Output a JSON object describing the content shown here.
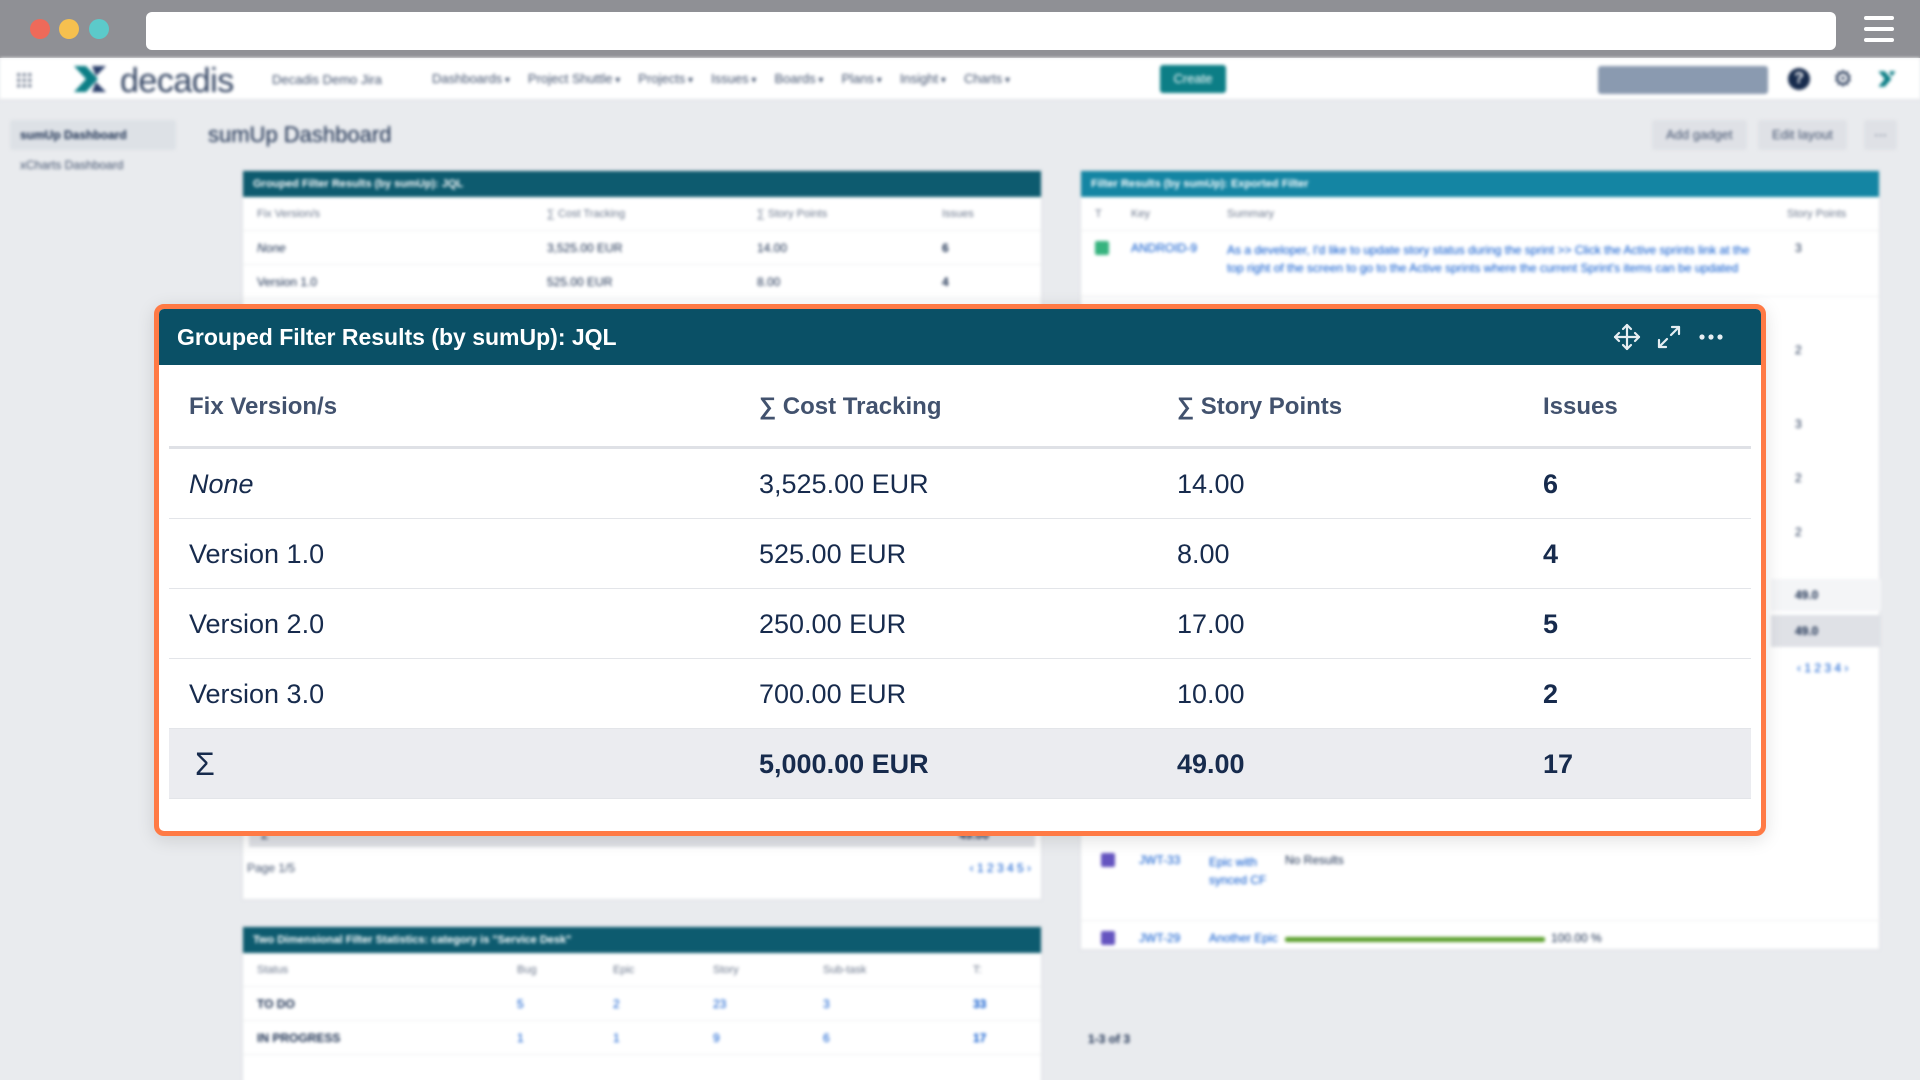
{
  "browser": {
    "url": ""
  },
  "nav": {
    "logo_text": "decadis",
    "site_name": "Decadis Demo Jira",
    "items": [
      "Dashboards",
      "Project Shuttle",
      "Projects",
      "Issues",
      "Boards",
      "Plans",
      "Insight",
      "Charts"
    ],
    "create_label": "Create",
    "help_glyph": "?",
    "gear_glyph": "⚙"
  },
  "sidebar": {
    "items": [
      "sumUp Dashboard",
      "xCharts Dashboard"
    ]
  },
  "dashboard": {
    "title": "sumUp Dashboard",
    "add_gadget_label": "Add gadget",
    "edit_layout_label": "Edit layout",
    "more_label": "···"
  },
  "bg_gadgets": {
    "grouped_title": "Grouped Filter Results (by sumUp): JQL",
    "grouped_page": "Page 1/5",
    "grouped_pages": "‹ 1 2 3 4 5 ›",
    "filter_title": "Filter Results (by sumUp): Exported Filter",
    "filter_cols": [
      "T",
      "Key",
      "Summary",
      "Story Points"
    ],
    "filter_key": "ANDROID-9",
    "filter_summary": "As a developer, I'd like to update story status during the sprint >> Click the Active sprints link at the top right of the screen to go to the Active sprints where the current Sprint's items can be updated",
    "filter_sp": [
      "3",
      "2",
      "3",
      "2",
      "2"
    ],
    "filter_total": "49.0",
    "filter_pages": "‹ 1 2 3 4 ›",
    "jwt33_key": "JWT-33",
    "jwt33_type": "Epic with synced CF",
    "jwt33_result": "No Results",
    "jwt29_key": "JWT-29",
    "jwt29_type": "Another Epic",
    "jwt29_pct": "100.00 %",
    "jwt29_progress": 1.0,
    "range": "1-3 of 3",
    "two_dim_title": "Two Dimensional Filter Statistics: category is \"Service Desk\"",
    "two_dim_cols": [
      "Status",
      "Bug",
      "Epic",
      "Story",
      "Sub-task",
      "T:"
    ],
    "two_dim_rows": [
      {
        "status": "TO DO",
        "vals": [
          "5",
          "2",
          "23",
          "3",
          "33"
        ]
      },
      {
        "status": "IN PROGRESS",
        "vals": [
          "1",
          "1",
          "9",
          "6",
          "17"
        ]
      }
    ]
  },
  "focus": {
    "title": "Grouped Filter Results (by sumUp): JQL",
    "columns": [
      "Fix Version/s",
      "∑ Cost Tracking",
      "∑ Story Points",
      "Issues"
    ],
    "rows": [
      {
        "version": "None",
        "cost": "3,525.00 EUR",
        "points": "14.00",
        "issues": "6"
      },
      {
        "version": "Version 1.0",
        "cost": "525.00 EUR",
        "points": "8.00",
        "issues": "4"
      },
      {
        "version": "Version 2.0",
        "cost": "250.00 EUR",
        "points": "17.00",
        "issues": "5"
      },
      {
        "version": "Version 3.0",
        "cost": "700.00 EUR",
        "points": "10.00",
        "issues": "2"
      }
    ],
    "total": {
      "symbol": "Σ",
      "cost": "5,000.00 EUR",
      "points": "49.00",
      "issues": "17"
    }
  },
  "colors": {
    "header": "#0a5066",
    "highlight_border": "#ff7a45",
    "create_button": "#0c7e86",
    "total_row": "#ebecf0"
  }
}
